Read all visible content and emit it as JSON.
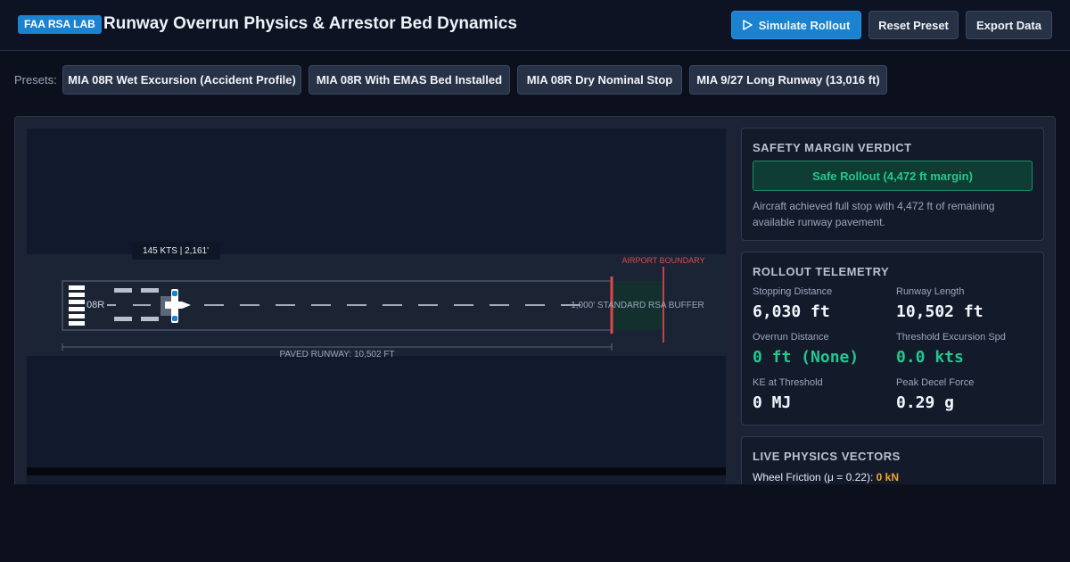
{
  "header": {
    "badge": "FAA RSA LAB",
    "title": "Runway Overrun Physics & Arrestor Bed Dynamics",
    "simulate_label": "Simulate Rollout",
    "reset_label": "Reset Preset",
    "export_label": "Export Data"
  },
  "presets": {
    "label": "Presets:",
    "items": [
      "MIA 08R Wet Excursion (Accident Profile)",
      "MIA 08R With EMAS Bed Installed",
      "MIA 08R Dry Nominal Stop",
      "MIA 9/27 Long Runway (13,016 ft)"
    ]
  },
  "viz": {
    "aircraft_readout": "145 KTS | 2,161'",
    "runway_id": "08R",
    "boundary_label": "AIRPORT BOUNDARY",
    "rsa_label": "1,000' STANDARD RSA BUFFER",
    "paved_label": "PAVED RUNWAY: 10,502 FT"
  },
  "verdict": {
    "heading": "SAFETY MARGIN VERDICT",
    "status": "Safe Rollout (4,472 ft margin)",
    "description": "Aircraft achieved full stop with 4,472 ft of remaining available runway pavement."
  },
  "telemetry": {
    "heading": "ROLLOUT TELEMETRY",
    "stopping_distance_label": "Stopping Distance",
    "stopping_distance": "6,030 ft",
    "runway_length_label": "Runway Length",
    "runway_length": "10,502 ft",
    "overrun_label": "Overrun Distance",
    "overrun": "0 ft (None)",
    "excursion_label": "Threshold Excursion Spd",
    "excursion": "0.0 kts",
    "ke_label": "KE at Threshold",
    "ke": "0 MJ",
    "decel_label": "Peak Decel Force",
    "decel": "0.29 g"
  },
  "vectors": {
    "heading": "LIVE PHYSICS VECTORS",
    "friction_label": "Wheel Friction (μ = 0.22):",
    "friction_value": "0 kN"
  },
  "colors": {
    "accent": "#1a82cf",
    "safe": "#22c88f",
    "boundary": "#e04848",
    "warning": "#f0a32a"
  }
}
